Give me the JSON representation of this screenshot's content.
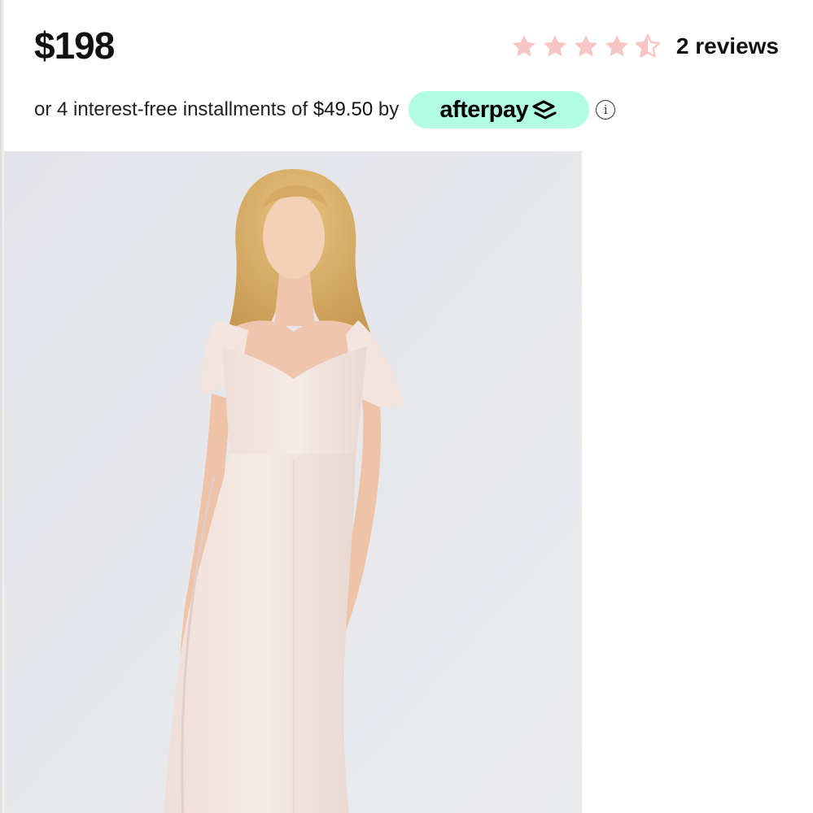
{
  "product": {
    "price": "$198",
    "rating": {
      "value": 4.5,
      "max": 5,
      "reviews_label": "2 reviews",
      "star_color": "#f7c6c4"
    },
    "installments": {
      "prefix": "or 4 interest-free installments of ",
      "amount": "$49.50",
      "suffix": " by",
      "provider": "afterpay",
      "badge_color": "#b2fce4"
    },
    "image": {
      "description_icon": "product-photo",
      "dress_color": "#f3e6e1",
      "background_color": "#e7e8ec"
    }
  }
}
